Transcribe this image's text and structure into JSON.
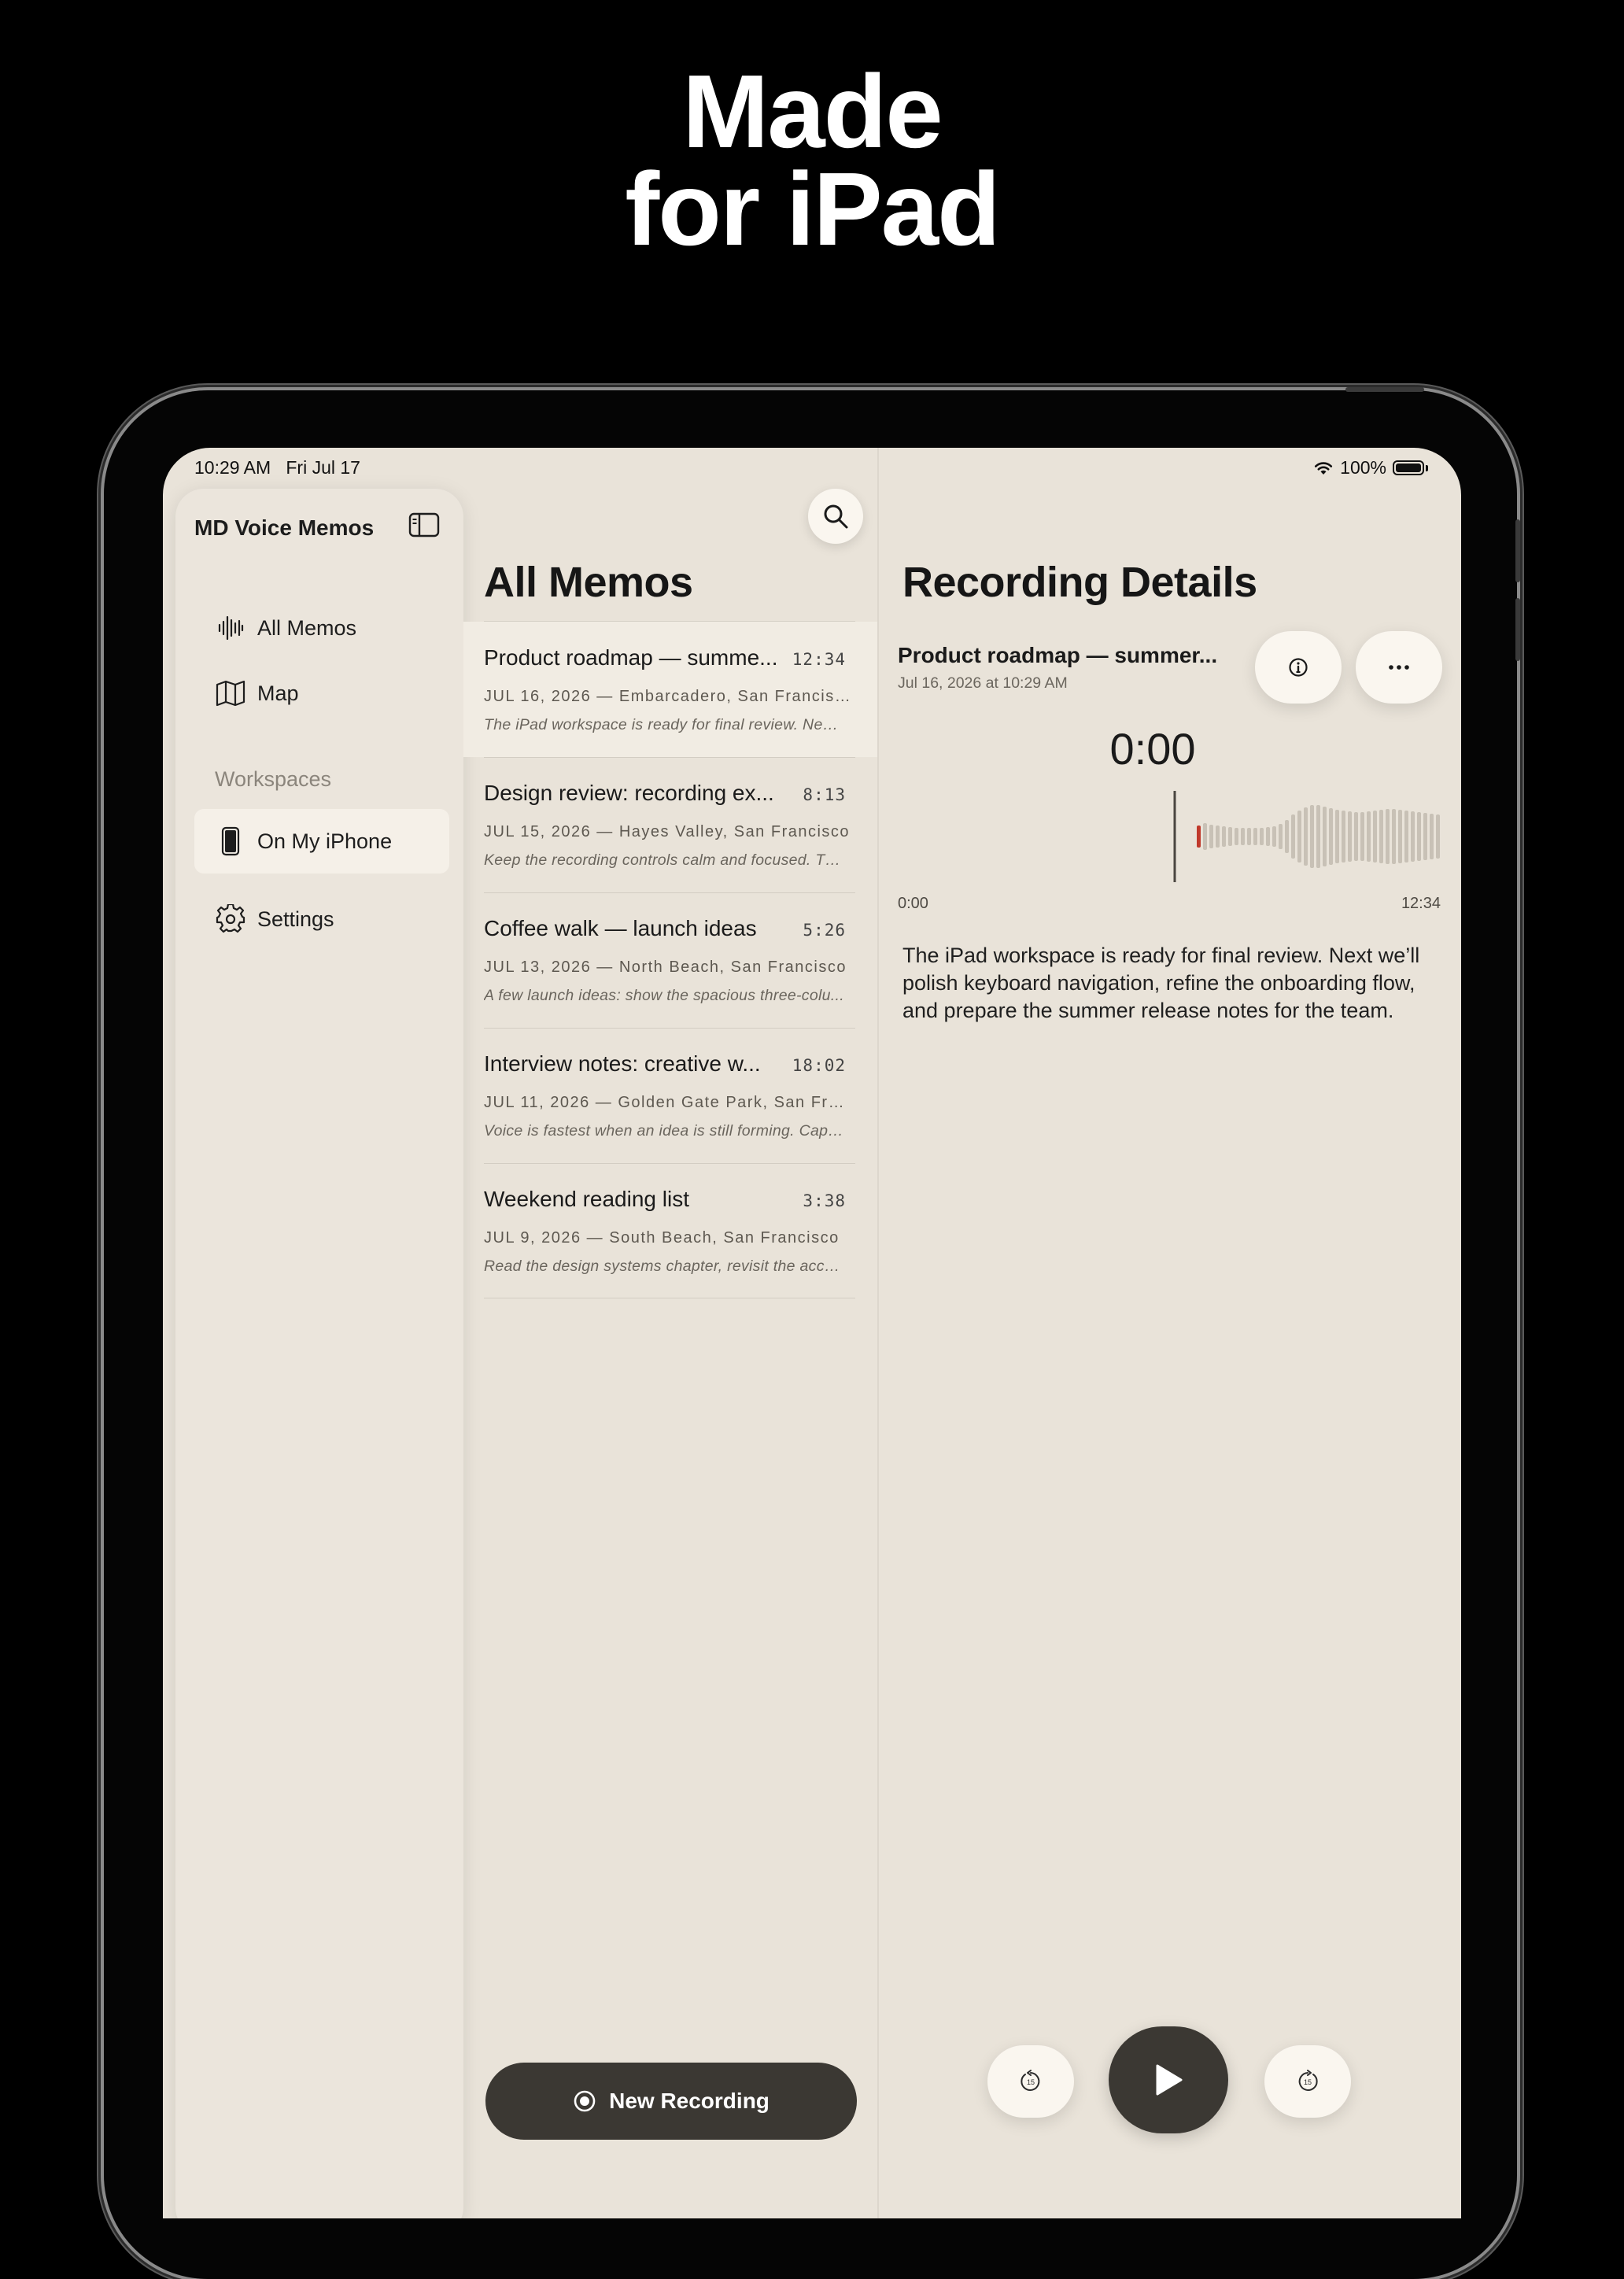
{
  "headline": {
    "line1": "Made",
    "line2": "for iPad"
  },
  "status_bar": {
    "time": "10:29 AM",
    "date": "Fri Jul 17",
    "battery": "100%"
  },
  "sidebar": {
    "title": "MD Voice Memos",
    "items": [
      {
        "label": "All Memos",
        "icon": "waveform-icon"
      },
      {
        "label": "Map",
        "icon": "map-icon"
      }
    ],
    "section_label": "Workspaces",
    "workspace_items": [
      {
        "label": "On My iPhone",
        "icon": "iphone-icon",
        "selected": true
      }
    ],
    "settings_label": "Settings"
  },
  "list": {
    "title": "All Memos",
    "memos": [
      {
        "title": "Product roadmap — summer release",
        "display_title": "Product roadmap — summe...",
        "duration": "12:34",
        "date": "JUL 16, 2026",
        "location": "Embarcadero, San Francisco",
        "snippet": "The iPad workspace is ready for final review. Next...",
        "selected": true
      },
      {
        "title": "Design review: recording experience",
        "display_title": "Design review: recording ex...",
        "duration": "8:13",
        "date": "JUL 15, 2026",
        "location": "Hayes Valley, San Francisco",
        "snippet": "Keep the recording controls calm and focused. Th...",
        "selected": false
      },
      {
        "title": "Coffee walk — launch ideas",
        "display_title": "Coffee walk — launch ideas",
        "duration": "5:26",
        "date": "JUL 13, 2026",
        "location": "North Beach, San Francisco",
        "snippet": "A few launch ideas: show the spacious three-colu...",
        "selected": false
      },
      {
        "title": "Interview notes: creative workflow",
        "display_title": "Interview notes: creative w...",
        "duration": "18:02",
        "date": "JUL 11, 2026",
        "location": "Golden Gate Park, San Franci...",
        "snippet": "Voice is fastest when an idea is still forming. Capt...",
        "selected": false
      },
      {
        "title": "Weekend reading list",
        "display_title": "Weekend reading list",
        "duration": "3:38",
        "date": "JUL 9, 2026",
        "location": "South Beach, San Francisco",
        "snippet": "Read the design systems chapter, revisit the acce...",
        "selected": false
      }
    ],
    "new_recording_label": "New Recording"
  },
  "detail": {
    "title": "Recording Details",
    "recording_name": "Product roadmap — summer...",
    "recording_date": "Jul 16, 2026 at 10:29 AM",
    "current_time": "0:00",
    "start_time": "0:00",
    "end_time": "12:34",
    "playback_progress": 0,
    "transcript": "The iPad workspace is ready for final review. Next we’ll polish keyboard navigation, refine the onboarding flow, and prepare the summer release notes for the team.",
    "skip_back_seconds": "15",
    "skip_forward_seconds": "15"
  },
  "colors": {
    "background": "#000000",
    "surface": "#e9e3d9",
    "selected_row": "#f1ece3",
    "primary_button": "#3b3833",
    "accent_red": "#c0392b",
    "waveform_bar": "#c8c1b6"
  }
}
